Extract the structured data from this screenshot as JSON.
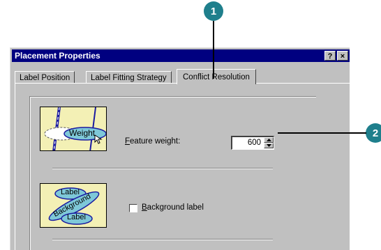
{
  "callouts": [
    {
      "number": "1"
    },
    {
      "number": "2"
    }
  ],
  "window": {
    "title": "Placement Properties",
    "help_button": "?",
    "close_button": "×"
  },
  "tabs": [
    {
      "label": "Label Position",
      "active": false
    },
    {
      "label": "Label Fitting Strategy",
      "active": false
    },
    {
      "label": "Conflict Resolution",
      "active": true
    }
  ],
  "feature_weight": {
    "preview_text": "Weight",
    "label_prefix": "",
    "label_accel": "F",
    "label_rest": "eature weight:",
    "value": "600"
  },
  "background_label": {
    "preview_texts": [
      "Label",
      "Background",
      "Label"
    ],
    "label_accel": "B",
    "label_rest": "ackground label",
    "checked": false
  },
  "colors": {
    "titlebar": "#000080",
    "callout": "#1f7f8c",
    "preview_bg": "#f3f0b5",
    "preview_label": "#7ec8d8",
    "road": "#1a1aa0"
  }
}
